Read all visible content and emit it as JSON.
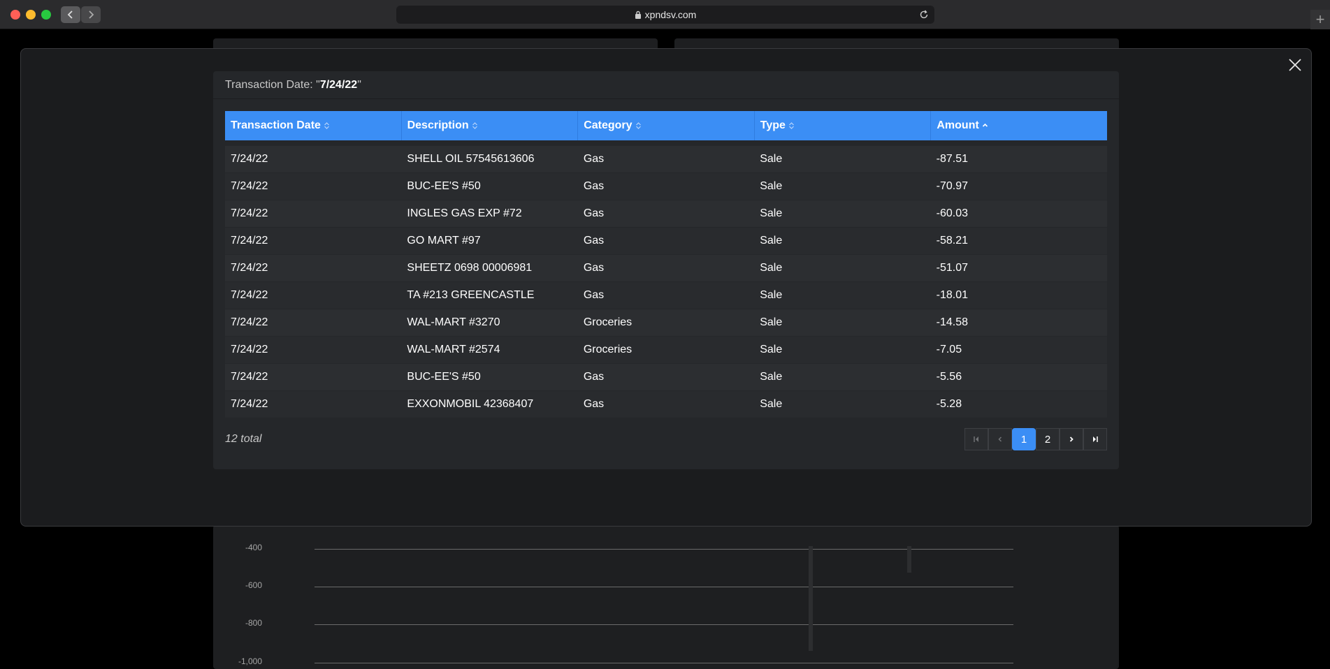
{
  "browser": {
    "url": "xpndsv.com"
  },
  "chart": {
    "ticks": [
      "-400",
      "-600",
      "-800",
      "-1,000"
    ]
  },
  "modal": {
    "header_prefix": "Transaction Date: \"",
    "header_value": "7/24/22",
    "header_suffix": "\"",
    "columns": [
      "Transaction Date",
      "Description",
      "Category",
      "Type",
      "Amount"
    ],
    "sorted_column": "Amount",
    "rows": [
      {
        "date": "7/24/22",
        "description": "SHELL OIL 57545613606",
        "category": "Gas",
        "type": "Sale",
        "amount": "-87.51"
      },
      {
        "date": "7/24/22",
        "description": "BUC-EE'S #50",
        "category": "Gas",
        "type": "Sale",
        "amount": "-70.97"
      },
      {
        "date": "7/24/22",
        "description": "INGLES GAS EXP #72",
        "category": "Gas",
        "type": "Sale",
        "amount": "-60.03"
      },
      {
        "date": "7/24/22",
        "description": "GO MART #97",
        "category": "Gas",
        "type": "Sale",
        "amount": "-58.21"
      },
      {
        "date": "7/24/22",
        "description": "SHEETZ 0698 00006981",
        "category": "Gas",
        "type": "Sale",
        "amount": "-51.07"
      },
      {
        "date": "7/24/22",
        "description": "TA #213 GREENCASTLE",
        "category": "Gas",
        "type": "Sale",
        "amount": "-18.01"
      },
      {
        "date": "7/24/22",
        "description": "WAL-MART #3270",
        "category": "Groceries",
        "type": "Sale",
        "amount": "-14.58"
      },
      {
        "date": "7/24/22",
        "description": "WAL-MART #2574",
        "category": "Groceries",
        "type": "Sale",
        "amount": "-7.05"
      },
      {
        "date": "7/24/22",
        "description": "BUC-EE'S #50",
        "category": "Gas",
        "type": "Sale",
        "amount": "-5.56"
      },
      {
        "date": "7/24/22",
        "description": "EXXONMOBIL 42368407",
        "category": "Gas",
        "type": "Sale",
        "amount": "-5.28"
      }
    ],
    "total_label": "12 total",
    "pages": [
      "1",
      "2"
    ],
    "current_page": "1",
    "colors": {
      "header_bg": "#3b8ef5",
      "panel_bg": "#25272a"
    }
  }
}
